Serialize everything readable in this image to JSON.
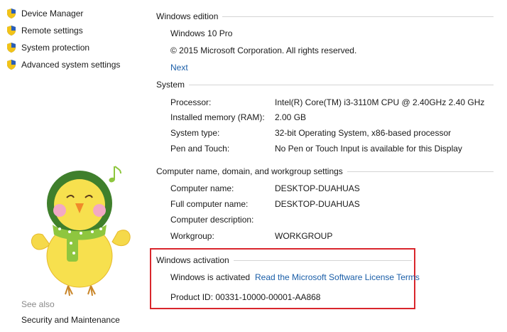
{
  "sidebar": {
    "items": [
      {
        "label": "Device Manager",
        "icon": "shield-icon"
      },
      {
        "label": "Remote settings",
        "icon": "shield-icon"
      },
      {
        "label": "System protection",
        "icon": "shield-icon"
      },
      {
        "label": "Advanced system settings",
        "icon": "shield-icon"
      }
    ],
    "see_also_heading": "See also",
    "see_also_links": [
      {
        "label": "Security and Maintenance"
      }
    ]
  },
  "windows_edition": {
    "heading": "Windows edition",
    "edition": "Windows 10 Pro",
    "copyright": "© 2015 Microsoft Corporation. All rights reserved.",
    "next_link": "Next"
  },
  "system": {
    "heading": "System",
    "rows": [
      {
        "label": "Processor:",
        "value": "Intel(R) Core(TM) i3-3110M CPU @ 2.40GHz   2.40 GHz"
      },
      {
        "label": "Installed memory (RAM):",
        "value": "2.00 GB"
      },
      {
        "label": "System type:",
        "value": "32-bit Operating System, x86-based processor"
      },
      {
        "label": "Pen and Touch:",
        "value": "No Pen or Touch Input is available for this Display"
      }
    ]
  },
  "computer_name": {
    "heading": "Computer name, domain, and workgroup settings",
    "rows": [
      {
        "label": "Computer name:",
        "value": "DESKTOP-DUAHUAS"
      },
      {
        "label": "Full computer name:",
        "value": "DESKTOP-DUAHUAS"
      },
      {
        "label": "Computer description:",
        "value": ""
      },
      {
        "label": "Workgroup:",
        "value": "WORKGROUP"
      }
    ]
  },
  "activation": {
    "heading": "Windows activation",
    "status": "Windows is activated",
    "license_link": "Read the Microsoft Software License Terms",
    "product_id": "Product ID:  00331-10000-00001-AA868"
  },
  "colors": {
    "link": "#1a5ea8",
    "highlight_border": "#d9262c",
    "rule": "#d4d4d4"
  }
}
